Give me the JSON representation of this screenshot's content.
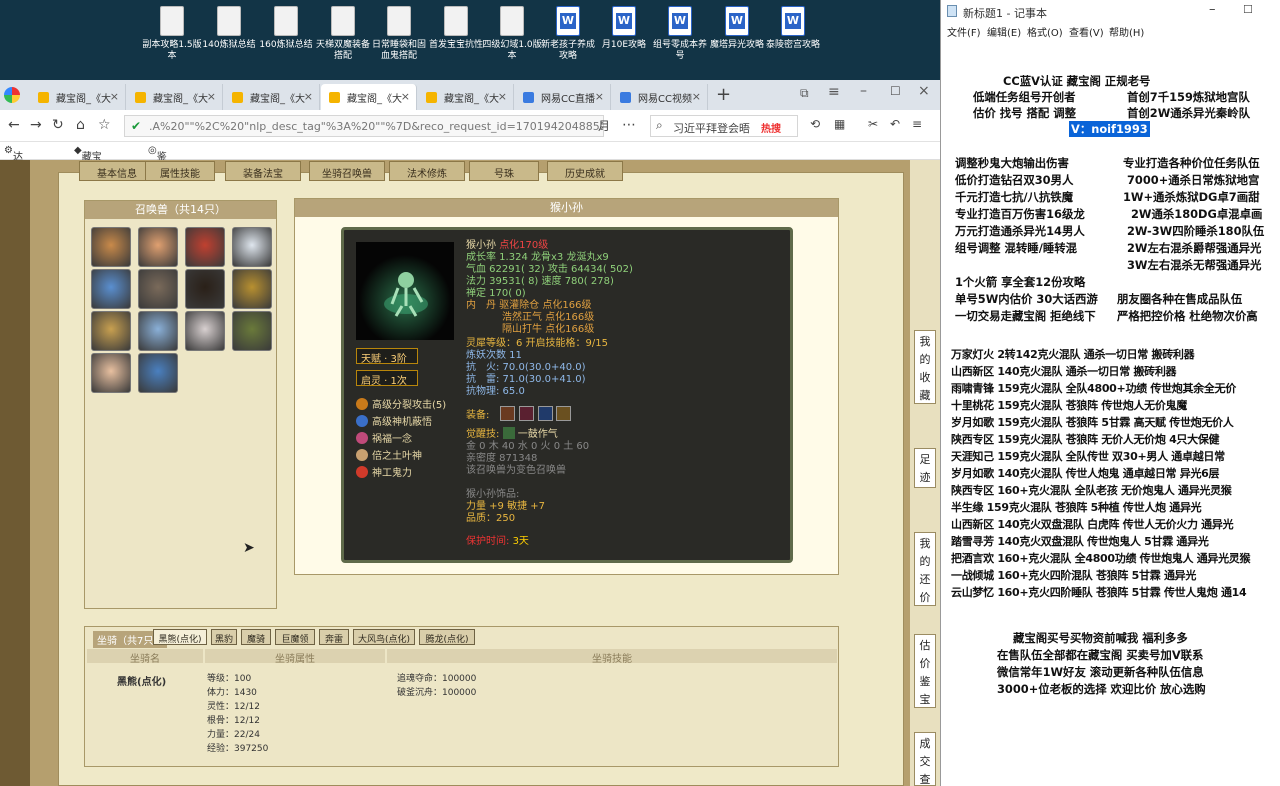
{
  "desktop": {
    "icons": [
      {
        "label": "副本攻略1.5版本",
        "type": "doc"
      },
      {
        "label": "140炼狱总结",
        "type": "doc"
      },
      {
        "label": "160炼狱总结",
        "type": "doc"
      },
      {
        "label": "天梯双魔装备搭配",
        "type": "doc"
      },
      {
        "label": "日常睡袋和固血鬼搭配",
        "type": "doc"
      },
      {
        "label": "首发宝宝抗性",
        "type": "doc"
      },
      {
        "label": "四级幻域1.0版本",
        "type": "doc"
      },
      {
        "label": "新老孩子养成攻略",
        "type": "word"
      },
      {
        "label": "月10E攻略",
        "type": "word"
      },
      {
        "label": "组号零成本养号",
        "type": "word"
      },
      {
        "label": "魔塔异光攻略",
        "type": "word"
      },
      {
        "label": "泰陵密宫攻略",
        "type": "word"
      }
    ]
  },
  "browser": {
    "tabs": [
      {
        "label": "藏宝阁_《大"
      },
      {
        "label": "藏宝阁_《大"
      },
      {
        "label": "藏宝阁_《大"
      },
      {
        "label": "藏宝阁_《大",
        "active": true
      },
      {
        "label": "藏宝阁_《大"
      },
      {
        "label": "网易CC直播"
      },
      {
        "label": "网易CC视频"
      }
    ],
    "url": ".A%20\"\"%2C%20\"nlp_desc_tag\"%3A%20\"\"%7D&reco_request_id=1701942048852xhamu",
    "search_text": "习近平拜登会晤",
    "hot_label": "热搜",
    "bookmarks": [
      "达人后台",
      "藏宝阁_《大",
      "鉴宝广场"
    ]
  },
  "game": {
    "top_tabs": [
      "基本信息",
      "属性技能",
      "装备法宝",
      "坐骑召唤兽",
      "法术修炼",
      "号珠",
      "历史成就"
    ],
    "pet_list_title": "召唤兽（共14只）",
    "pet_colors": [
      "#c98a4a",
      "#e0a070",
      "#c04030",
      "#dfe6ee",
      "#5a8fd0",
      "#7a6a5a",
      "#2a2018",
      "#b89030",
      "#c8a050",
      "#8ab0d8",
      "#d8d0d0",
      "#6a7a3a",
      "#e8c0a0",
      "#4a80c0"
    ],
    "pet_name_header": "猴小孙",
    "card": {
      "name": "猴小孙",
      "name_suffix": "点化170级",
      "line_growth": "成长率 1.324 龙骨x3 龙涎丸x9",
      "line_hp": "气血 62291( 32) 攻击 64434( 502)",
      "line_mp": "法力 39531( 8) 速度 780( 278)",
      "line_zen": "禅定 170( 0)",
      "line_dan1": "内　丹 驱灌除仓 点化166级",
      "line_dan2": "浩然正气 点化166级",
      "line_dan3": "隔山打牛 点化166级",
      "line_soul": "灵犀等级：6 开启技能格：9/15",
      "line_refine": "炼妖次数 11",
      "line_fire": "抗　火: 70.0(30.0+40.0)",
      "line_thunder": "抗　雷: 71.0(30.0+41.0)",
      "line_phys": "抗物理: 65.0",
      "equip_label": "装备:",
      "awaken_label": "觉醒技:",
      "awaken_skill": "一鼓作气",
      "elements": "金 0 木 40 水 0 火 0 土 60",
      "intimacy": "亲密度 871348",
      "note": "该召唤兽为变色召唤兽",
      "accessory_title": "猴小孙饰品:",
      "accessory_stats": "力量 +9 敏捷 +7",
      "accessory_quality": "品质：250",
      "protect_label": "保护时间:",
      "protect_value": "3天",
      "badge1": "天赋 · 3阶",
      "badge2": "启灵 · 1次",
      "skills": [
        {
          "label": "高级分裂攻击(5)",
          "color": "#c97a1a"
        },
        {
          "label": "高级神机蔽悟",
          "color": "#3a6fc8"
        },
        {
          "label": "祸福一念",
          "color": "#c04a7a"
        },
        {
          "label": "倍之土叶神",
          "color": "#c8a070"
        },
        {
          "label": "神工鬼力",
          "color": "#d03a2a"
        }
      ]
    },
    "mount": {
      "title": "坐骑（共7只）",
      "tabs": [
        "黑熊(点化)",
        "黑豹",
        "魔骑",
        "巨魔领",
        "奔雷",
        "大风鸟(点化)",
        "腾龙(点化)"
      ],
      "headers": [
        "坐骑名",
        "坐骑属性",
        "坐骑技能"
      ],
      "name": "黑熊(点化)",
      "stats": [
        "等级：100",
        "体力：1430",
        "灵性：12/12",
        "根骨：12/12",
        "力量：22/24",
        "经验：397250"
      ],
      "skills": [
        "追魂夺命：100000",
        "破釜沉舟：100000"
      ]
    },
    "side_blocks": [
      "我的收藏",
      "足迹",
      "我的还价",
      "估价鉴宝",
      "成交查询"
    ]
  },
  "notepad": {
    "title": "新标题1 - 记事本",
    "menu": [
      "文件(F)",
      "编辑(E)",
      "格式(O)",
      "查看(V)",
      "帮助(H)"
    ],
    "lines": [
      "CC蓝V认证  藏宝阁 正规老号",
      "低端任务组号开创者",
      "首创7千159炼狱地宫队",
      "估价 找号 搭配 调整",
      "首创2W通杀异光秦岭队",
      "V：noif1993",
      "调整秒鬼大炮输出伤害",
      "专业打造各种价位任务队伍",
      "低价打造钻召双30男人",
      "7000+通杀日常炼狱地宫",
      "千元打造七抗/八抗铁魔",
      "1W+通杀炼狱DG卓7画甜",
      "专业打造百万伤害16级龙",
      "2W通杀180DG卓混卓画",
      "万元打造通杀异光14男人",
      "2W-3W四阶睡杀180队伍",
      "组号调整 混转睡/睡转混",
      "2W左右混杀爵帮强通异光",
      "3W左右混杀无帮强通异光",
      "1个火箭 享全套12份攻略",
      "单号5W内估价 30大话西游",
      "朋友圈各种在售成品队伍",
      "一切交易走藏宝阁 拒绝线下",
      "严格把控价格 杜绝物次价高",
      "万家灯火 2转142克火混队 通杀一切日常 搬砖利器",
      "山西新区 140克火混队 通杀一切日常 搬砖利器",
      "雨啸青锋 159克火混队 全队4800+功绩 传世炮其余全无价",
      "十里桃花 159克火混队 苍狼阵 传世炮人无价鬼魔",
      "岁月如歌 159克火混队 苍狼阵 5甘霖 高天赋 传世炮无价人",
      "陕西专区 159克火混队 苍狼阵 无价人无价炮 4只大保健",
      "天涯知己 159克火混队 全队传世 双30+男人 通卓越日常",
      "岁月如歌 140克火混队 传世人炮鬼 通卓越日常 异光6层",
      "陕西专区 160+克火混队 全队老孩 无价炮鬼人 通异光灵猴",
      "半生缘 159克火混队 苍狼阵 5种植 传世人炮 通异光",
      "山西新区 140克火双盘混队 白虎阵 传世人无价火力 通异光",
      "踏雪寻芳 140克火双盘混队 传世炮鬼人 5甘霖 通异光",
      "把酒言欢 160+克火混队 全4800功绩 传世炮鬼人 通异光灵猴",
      "一战倾城 160+克火四阶混队 苍狼阵 5甘霖 通异光",
      "云山梦忆 160+克火四阶睡队 苍狼阵 5甘霖 传世人鬼炮 通14",
      "藏宝阁买号买物资前喊我 福利多多",
      "在售队伍全部都在藏宝阁 买卖号加V联系",
      "微信常年1W好友 滚动更新各种队伍信息",
      "3000+位老板的选择 欢迎比价 放心选购"
    ]
  }
}
